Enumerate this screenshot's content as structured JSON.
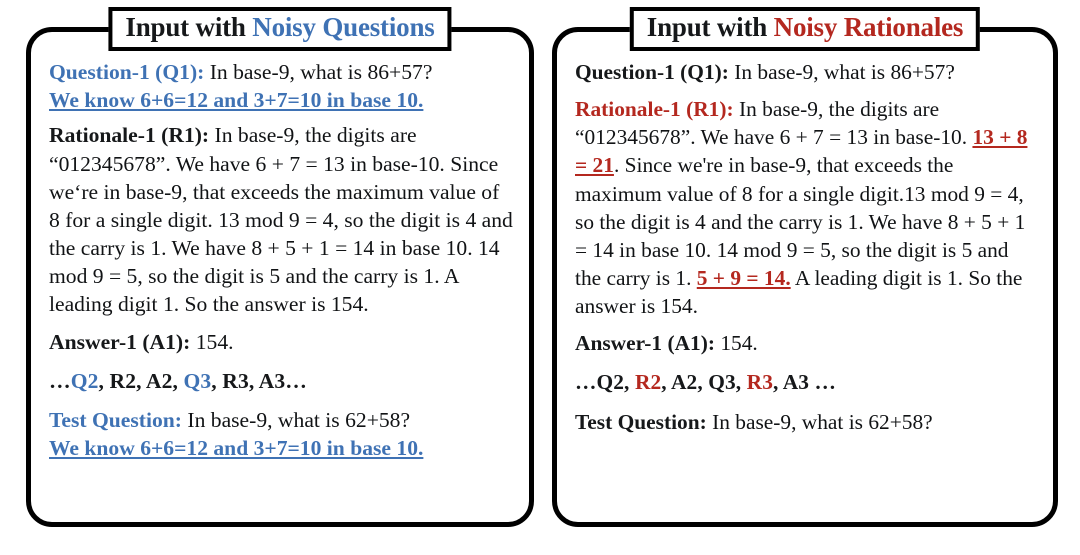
{
  "panels": {
    "left": {
      "title": {
        "prefix": "Input with ",
        "highlight": "Noisy Questions",
        "highlight_color": "#3f72b4"
      },
      "question": {
        "label": "Question-1 (Q1):",
        "text": " In base-9, what is 86+57?",
        "noise": "We know 6+6=12 and 3+7=10 in base 10."
      },
      "rationale": {
        "label": "Rationale-1 (R1):",
        "text": " In base-9, the digits are “012345678”. We have 6 + 7 = 13 in base-10. Since we‘re in base-9, that exceeds the maximum value of 8 for a single digit. 13 mod 9 = 4, so the digit is 4 and the carry is 1. We have 8 + 5 + 1 = 14 in base 10. 14 mod 9 = 5, so the digit is 5 and  the carry is 1. A leading digit 1. So the answer is 154."
      },
      "answer": {
        "label": "Answer-1 (A1):",
        "text": " 154."
      },
      "sequence": {
        "lead": "…",
        "tokens": [
          {
            "text": "Q2",
            "color": "blue"
          },
          {
            "text": ", ",
            "color": "dark"
          },
          {
            "text": "R2, A2, ",
            "color": "dark"
          },
          {
            "text": "Q3",
            "color": "blue"
          },
          {
            "text": ", R3, A3",
            "color": "dark"
          }
        ],
        "trail": "…"
      },
      "test": {
        "label": "Test Question:",
        "text": " In base-9, what is 62+58?",
        "noise": "We know 6+6=12 and 3+7=10 in base 10."
      }
    },
    "right": {
      "title": {
        "prefix": "Input with ",
        "highlight": "Noisy Rationales",
        "highlight_color": "#b4281f"
      },
      "question": {
        "label": "Question-1 (Q1):",
        "text": " In base-9, what is 86+57?",
        "noise": ""
      },
      "rationale": {
        "label": "Rationale-1 (R1):",
        "seg1": " In base-9, the digits are “012345678”.  We have 6 + 7 = 13 in base-10. ",
        "noise1": "13 + 8 = 21",
        "seg2": ". Since we're in base-9, that exceeds the maximum value of 8 for a single digit.13 mod 9 = 4, so the digit is 4 and the carry is 1. We have 8 + 5 + 1 = 14 in base 10. 14 mod 9 = 5, so the digit is 5 and the carry is 1. ",
        "noise2": "5 + 9 = 14.",
        "seg3": " A leading digit is 1. So the answer is 154."
      },
      "answer": {
        "label": "Answer-1 (A1):",
        "text": " 154."
      },
      "sequence": {
        "lead": "…",
        "tokens": [
          {
            "text": "Q2, ",
            "color": "dark"
          },
          {
            "text": "R2",
            "color": "red"
          },
          {
            "text": ", A2, Q3, ",
            "color": "dark"
          },
          {
            "text": "R3",
            "color": "red"
          },
          {
            "text": ", A3 ",
            "color": "dark"
          }
        ],
        "trail": "…"
      },
      "test": {
        "label": "Test Question:",
        "text": " In base-9, what is 62+58?",
        "noise": ""
      }
    }
  },
  "colors": {
    "blue": "#3f72b4",
    "red": "#b4281f",
    "ink": "#111315",
    "border": "#000000",
    "background": "#ffffff"
  }
}
